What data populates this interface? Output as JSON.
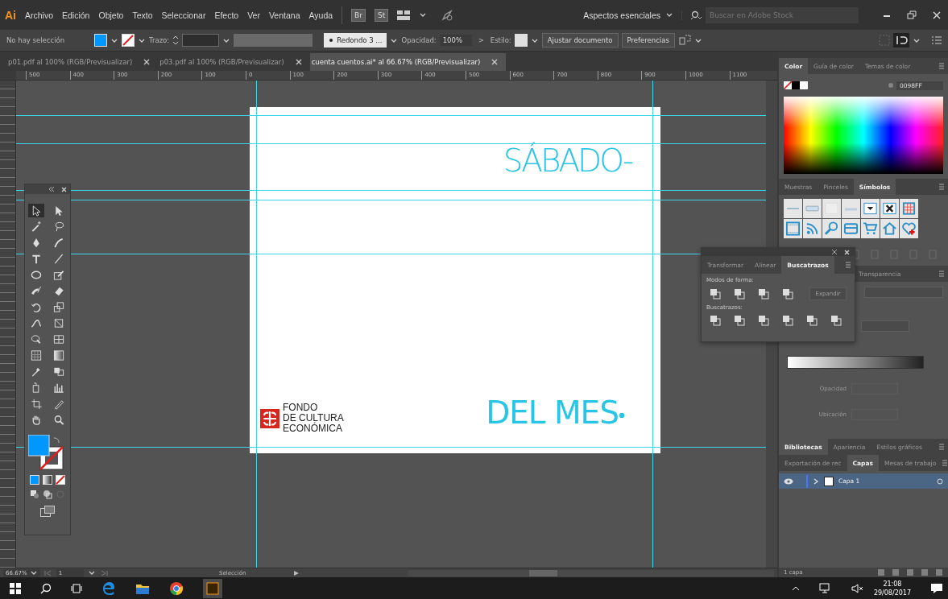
{
  "app_logo": "Ai",
  "menu": [
    "Archivo",
    "Edición",
    "Objeto",
    "Texto",
    "Seleccionar",
    "Efecto",
    "Ver",
    "Ventana",
    "Ayuda"
  ],
  "bridge_buttons": [
    "Br",
    "St"
  ],
  "workspace": "Aspectos esenciales",
  "stock_search": {
    "placeholder": "Buscar en Adobe Stock"
  },
  "control_bar": {
    "selection": "No hay selección",
    "stroke_label": "Trazo:",
    "brush": "Redondo 3 ...",
    "opacity_label": "Opacidad:",
    "opacity": "100%",
    "more": ">",
    "style_label": "Estilo:",
    "buttons": [
      "Ajustar documento",
      "Preferencias"
    ]
  },
  "document_tabs": [
    {
      "label": "p01.pdf al 100% (RGB/Previsualizar)",
      "selected": false
    },
    {
      "label": "p03.pdf al 100% (RGB/Previsualizar)",
      "selected": false
    },
    {
      "label": "cuenta cuentos.ai* al 66.67% (RGB/Previsualizar)",
      "selected": true
    }
  ],
  "ruler": [
    "500",
    "400",
    "300",
    "200",
    "100",
    "0",
    "100",
    "200",
    "300",
    "400",
    "500",
    "600",
    "700",
    "800",
    "900",
    "1000",
    "1100"
  ],
  "artboard": {
    "headline": "SÁBADO-",
    "footer": "DEL MES",
    "logo_lines": [
      "FONDO",
      "DE CULTURA",
      "ECONÓMICA"
    ]
  },
  "color_panel": {
    "tabs": [
      {
        "label": "Color",
        "selected": true
      },
      {
        "label": "Guía de color",
        "selected": false
      },
      {
        "label": "Temas de color",
        "selected": false
      }
    ],
    "hex": "0098FF"
  },
  "symbols_panel": {
    "tabs": [
      {
        "label": "Muestras",
        "selected": false
      },
      {
        "label": "Pinceles",
        "selected": false
      },
      {
        "label": "Símbolos",
        "selected": true
      }
    ]
  },
  "pathfinder_panel": {
    "tabs": [
      {
        "label": "Transformar",
        "selected": false
      },
      {
        "label": "Alinear",
        "selected": false
      },
      {
        "label": "Buscatrazos",
        "selected": true
      }
    ],
    "shape_modes_label": "Modos de forma:",
    "expand": {
      "label": "Expandir",
      "disabled": true
    },
    "pathfinders_label": "Buscatrazos:"
  },
  "gradient_panel": {
    "tabs": [
      {
        "label": "Transparencia",
        "selected": false
      }
    ],
    "fields": [
      {
        "label": "Opacidad",
        "disabled": true
      },
      {
        "label": "Ubicación",
        "disabled": true
      }
    ]
  },
  "libraries_panel": {
    "tabs": [
      {
        "label": "Bibliotecas",
        "selected": true
      },
      {
        "label": "Apariencia",
        "selected": false
      },
      {
        "label": "Estilos gráficos",
        "selected": false
      }
    ]
  },
  "layers_panel": {
    "tabs": [
      {
        "label": "Exportación de rec",
        "selected": false
      },
      {
        "label": "Capas",
        "selected": true
      },
      {
        "label": "Mesas de trabajo",
        "selected": false
      }
    ],
    "layers": [
      {
        "name": "Capa 1",
        "visible": true,
        "expanded": false,
        "selected": true
      }
    ],
    "count": "1 capa"
  },
  "status_bar": {
    "zoom": "66.67%",
    "artboard": "1",
    "tool": "Selección"
  },
  "taskbar": {
    "time": "21:08",
    "date": "29/08/2017"
  }
}
